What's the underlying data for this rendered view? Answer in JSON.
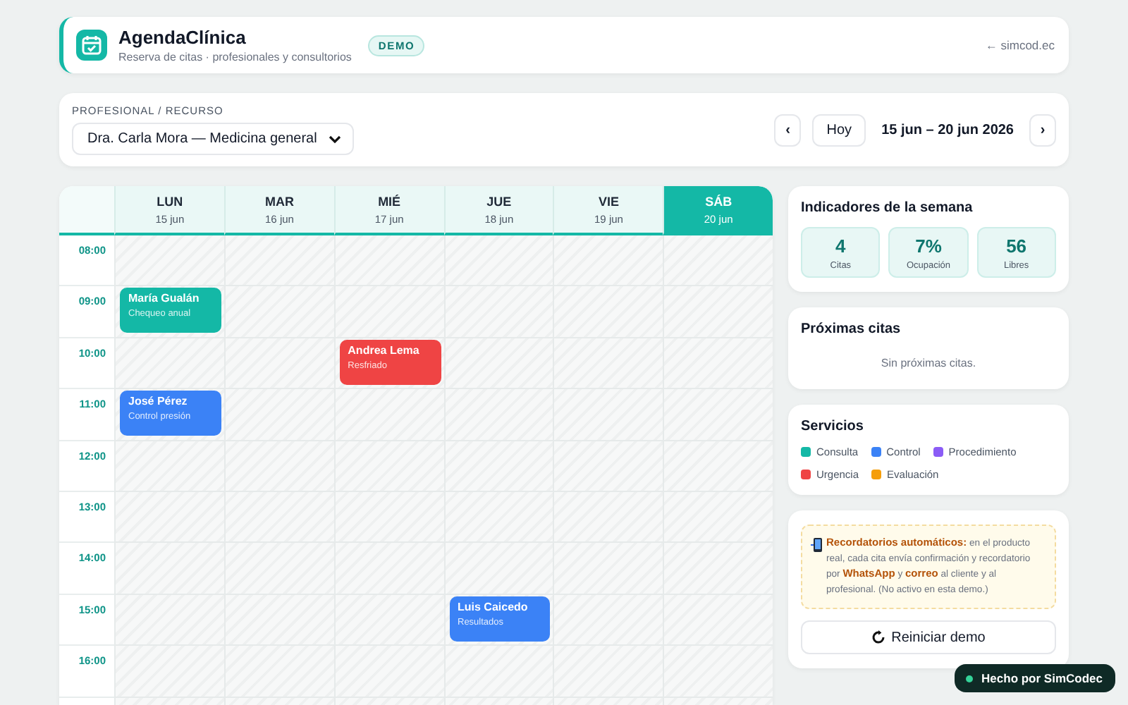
{
  "header": {
    "title": "AgendaClínica",
    "subtitle": "Reserva de citas · profesionales y consultorios",
    "badge": "DEMO",
    "link": "← simcod.ec"
  },
  "toolbar": {
    "label": "PROFESIONAL / RECURSO",
    "professional": "Dra. Carla Mora — Medicina general",
    "prev": "‹",
    "today": "Hoy",
    "range": "15 jun – 20 jun 2026",
    "next": "›"
  },
  "calendar": {
    "days": [
      {
        "name": "LUN",
        "date": "15 jun",
        "selected": false
      },
      {
        "name": "MAR",
        "date": "16 jun",
        "selected": false
      },
      {
        "name": "MIÉ",
        "date": "17 jun",
        "selected": false
      },
      {
        "name": "JUE",
        "date": "18 jun",
        "selected": false
      },
      {
        "name": "VIE",
        "date": "19 jun",
        "selected": false
      },
      {
        "name": "SÁB",
        "date": "20 jun",
        "selected": true
      }
    ],
    "rows": [
      {
        "time": "08:00",
        "cells": [
          {
            "kind": "free"
          },
          {
            "kind": "free"
          },
          {
            "kind": "free"
          },
          {
            "kind": "free"
          },
          {
            "kind": "free"
          },
          {
            "kind": "free"
          }
        ]
      },
      {
        "time": "09:00",
        "cells": [
          {
            "kind": "appointment",
            "patient": "María Gualán",
            "reason": "Chequeo anual",
            "color": "#14b8a6"
          },
          {
            "kind": "free"
          },
          {
            "kind": "free"
          },
          {
            "kind": "free"
          },
          {
            "kind": "free"
          },
          {
            "kind": "free"
          }
        ]
      },
      {
        "time": "10:00",
        "cells": [
          {
            "kind": "free"
          },
          {
            "kind": "free"
          },
          {
            "kind": "appointment",
            "patient": "Andrea Lema",
            "reason": "Resfriado",
            "color": "#ef4444"
          },
          {
            "kind": "free"
          },
          {
            "kind": "free"
          },
          {
            "kind": "free"
          }
        ]
      },
      {
        "time": "11:00",
        "cells": [
          {
            "kind": "appointment",
            "patient": "José Pérez",
            "reason": "Control presión",
            "color": "#3b82f6"
          },
          {
            "kind": "free"
          },
          {
            "kind": "free"
          },
          {
            "kind": "free"
          },
          {
            "kind": "free"
          },
          {
            "kind": "free"
          }
        ]
      },
      {
        "time": "12:00",
        "cells": [
          {
            "kind": "free"
          },
          {
            "kind": "free"
          },
          {
            "kind": "free"
          },
          {
            "kind": "free"
          },
          {
            "kind": "free"
          },
          {
            "kind": "free"
          }
        ]
      },
      {
        "time": "13:00",
        "cells": [
          {
            "kind": "free"
          },
          {
            "kind": "free"
          },
          {
            "kind": "free"
          },
          {
            "kind": "free"
          },
          {
            "kind": "free"
          },
          {
            "kind": "free"
          }
        ]
      },
      {
        "time": "14:00",
        "cells": [
          {
            "kind": "free"
          },
          {
            "kind": "free"
          },
          {
            "kind": "free"
          },
          {
            "kind": "free"
          },
          {
            "kind": "free"
          },
          {
            "kind": "free"
          }
        ]
      },
      {
        "time": "15:00",
        "cells": [
          {
            "kind": "free"
          },
          {
            "kind": "free"
          },
          {
            "kind": "free"
          },
          {
            "kind": "appointment",
            "patient": "Luis Caicedo",
            "reason": "Resultados",
            "color": "#3b82f6"
          },
          {
            "kind": "free"
          },
          {
            "kind": "free"
          }
        ]
      },
      {
        "time": "16:00",
        "cells": [
          {
            "kind": "free"
          },
          {
            "kind": "free"
          },
          {
            "kind": "free"
          },
          {
            "kind": "free"
          },
          {
            "kind": "free"
          },
          {
            "kind": "free"
          }
        ]
      }
    ]
  },
  "indicators": {
    "title": "Indicadores de la semana",
    "items": [
      {
        "value": "4",
        "label": "Citas"
      },
      {
        "value": "7%",
        "label": "Ocupación"
      },
      {
        "value": "56",
        "label": "Libres"
      }
    ]
  },
  "upcoming": {
    "title": "Próximas citas",
    "empty": "Sin próximas citas."
  },
  "services": {
    "title": "Servicios",
    "items": [
      {
        "label": "Consulta",
        "color": "#14b8a6"
      },
      {
        "label": "Control",
        "color": "#3b82f6"
      },
      {
        "label": "Procedimiento",
        "color": "#8b5cf6"
      },
      {
        "label": "Urgencia",
        "color": "#ef4444"
      },
      {
        "label": "Evaluación",
        "color": "#f59e0b"
      }
    ]
  },
  "reminder": {
    "text": "**Recordatorios automáticos:** en el producto real, cada cita envía confirmación y recordatorio por **WhatsApp** y **correo** al cliente y al profesional. (No activo en esta demo.)",
    "button": "Reiniciar demo"
  },
  "toast": "Hecho por SimCodec"
}
